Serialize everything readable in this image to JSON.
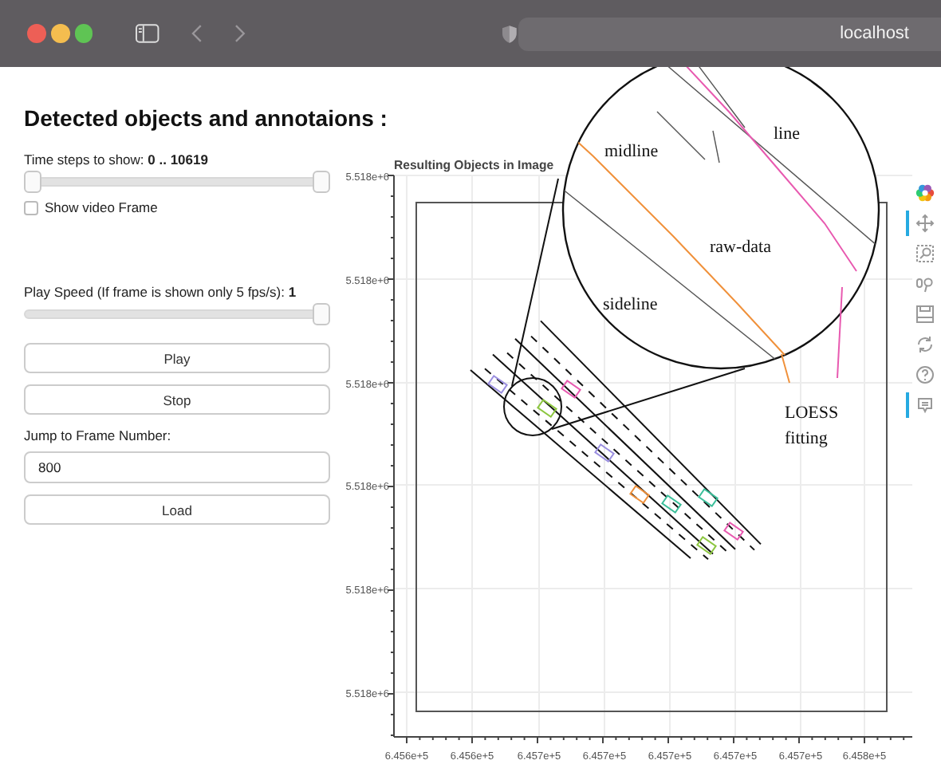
{
  "browser": {
    "address": "localhost"
  },
  "panel": {
    "title": "Detected objects and annotaions :",
    "time_steps": {
      "label": "Time steps to show: **0 .. 10619**",
      "handles": [
        {
          "level": 0
        },
        {
          "level": 1
        }
      ]
    },
    "show_video_frame": {
      "label": "Show video Frame",
      "checked": false
    },
    "play_speed": {
      "label": "Play Speed (If frame is shown only 5 fps/s): **1**",
      "level": 1
    },
    "buttons": [
      "Play",
      "Stop"
    ],
    "jump": {
      "label": "Jump to Frame Number:",
      "value": "800",
      "button": "Load"
    }
  },
  "plot": {
    "title": "Resulting Objects in Image",
    "y_tick_labels": [
      "5.518e+6",
      "5.518e+6",
      "5.518e+6",
      "5.518e+6",
      "5.518e+6",
      "5.518e+6"
    ],
    "x_tick_labels": [
      "6.456e+5",
      "6.456e+5",
      "6.457e+5",
      "6.457e+5",
      "6.457e+5",
      "6.457e+5",
      "6.457e+5",
      "6.458e+5"
    ],
    "annotations": [
      {
        "text": "midline"
      },
      {
        "text": "line"
      },
      {
        "text": "raw-data"
      },
      {
        "text": "sideline"
      },
      {
        "text": "LOESS fitting"
      }
    ]
  },
  "toolbar": [
    {
      "kind": "logo",
      "active": false
    },
    {
      "kind": "pan",
      "active": true
    },
    {
      "kind": "box-zoom",
      "active": false
    },
    {
      "kind": "wheel-zoom",
      "active": false
    },
    {
      "kind": "save",
      "active": false
    },
    {
      "kind": "reset",
      "active": false
    },
    {
      "kind": "help",
      "active": false
    },
    {
      "kind": "hover",
      "active": true
    }
  ]
}
